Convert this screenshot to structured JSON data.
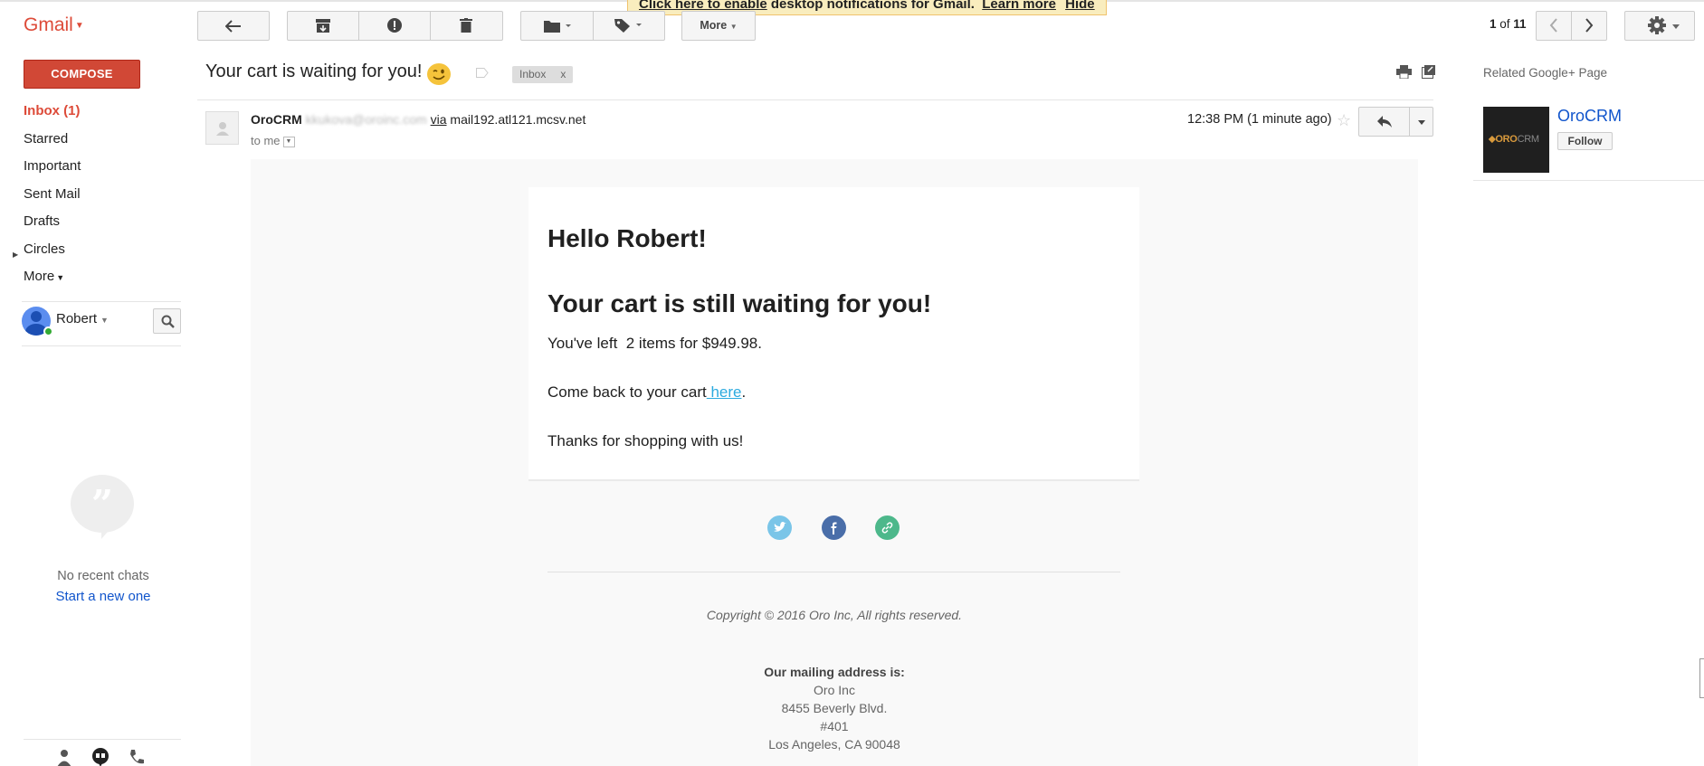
{
  "notice": {
    "enable_link": "Click here to enable",
    "text": " desktop notifications for Gmail.",
    "learn_more": "Learn more",
    "hide": "Hide"
  },
  "app": {
    "logo": "Gmail"
  },
  "compose_label": "COMPOSE",
  "nav": {
    "items": [
      {
        "label": "Inbox (1)"
      },
      {
        "label": "Starred"
      },
      {
        "label": "Important"
      },
      {
        "label": "Sent Mail"
      },
      {
        "label": "Drafts"
      },
      {
        "label": "Circles"
      },
      {
        "label": "More"
      }
    ]
  },
  "user": {
    "name": "Robert"
  },
  "chat": {
    "empty_text": "No recent chats",
    "start_link": "Start a new one"
  },
  "toolbar": {
    "more_label": "More"
  },
  "pager": {
    "current": "1",
    "separator": " of ",
    "total": "11"
  },
  "message": {
    "subject": "Your cart is waiting for you!",
    "label": "Inbox",
    "label_close": "x",
    "sender_name": "OroCRM",
    "sender_email": "kkukova@oroinc.com",
    "via_label": "via",
    "via_domain": "mail192.atl121.mcsv.net",
    "to": "to me",
    "time": "12:38 PM (1 minute ago)"
  },
  "email": {
    "greeting": "Hello Robert!",
    "headline": "Your cart is still waiting for you!",
    "items_line": "You've left  2 items for $949.98.",
    "comeback_prefix": "Come back to your cart",
    "comeback_link": " here",
    "comeback_suffix": ".",
    "thanks": "Thanks for shopping with us!",
    "copyright": "Copyright © 2016 Oro Inc, All rights reserved.",
    "address_title": "Our mailing address is:",
    "address_lines": [
      "Oro Inc",
      "8455 Beverly Blvd.",
      "#401",
      "Los Angeles, CA 90048"
    ]
  },
  "related": {
    "title": "Related Google+ Page",
    "org_name": "OroCRM",
    "follow_label": "Follow",
    "logo_text_a": "ORO",
    "logo_text_b": "CRM"
  },
  "colors": {
    "gmail_red": "#dd4b39",
    "compose": "#d14836",
    "link": "#1155cc",
    "email_link": "#2baadf",
    "twitter": "#7ac5e8",
    "facebook": "#4a6ea9",
    "website": "#4db88b"
  }
}
